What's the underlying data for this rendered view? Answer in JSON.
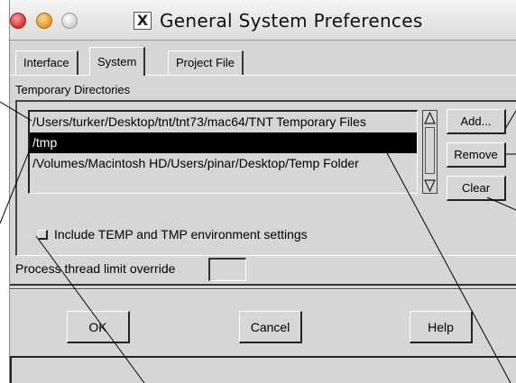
{
  "window": {
    "title": "General System Preferences",
    "x_icon": "X"
  },
  "tabs": [
    {
      "label": "Interface"
    },
    {
      "label": "System",
      "active": true
    },
    {
      "label": "Project File"
    }
  ],
  "temp_dirs": {
    "group_label": "Temporary Directories",
    "items": [
      {
        "path": "/Users/turker/Desktop/tnt/tnt73/mac64/TNT Temporary Files",
        "selected": false
      },
      {
        "path": "/tmp",
        "selected": true
      },
      {
        "path": "/Volumes/Macintosh HD/Users/pinar/Desktop/Temp Folder",
        "selected": false
      }
    ],
    "buttons": {
      "add": "Add...",
      "remove": "Remove",
      "clear": "Clear"
    }
  },
  "include_env": {
    "label": "Include TEMP and TMP environment settings",
    "checked": false
  },
  "thread_limit": {
    "label": "Process thread limit override",
    "value": ""
  },
  "footer": {
    "ok": "OK",
    "cancel": "Cancel",
    "help": "Help"
  },
  "icons": {
    "close": "close-icon",
    "minimize": "minimize-icon",
    "zoom": "zoom-icon",
    "app": "x11-icon",
    "scroll_up": "up-arrow-icon",
    "scroll_down": "down-arrow-icon"
  },
  "colors": {
    "window_bg": "#d6d6d6",
    "selection_bg": "#000000",
    "selection_fg": "#ffffff",
    "close": "#d8312a",
    "minimize": "#e39a1c"
  }
}
